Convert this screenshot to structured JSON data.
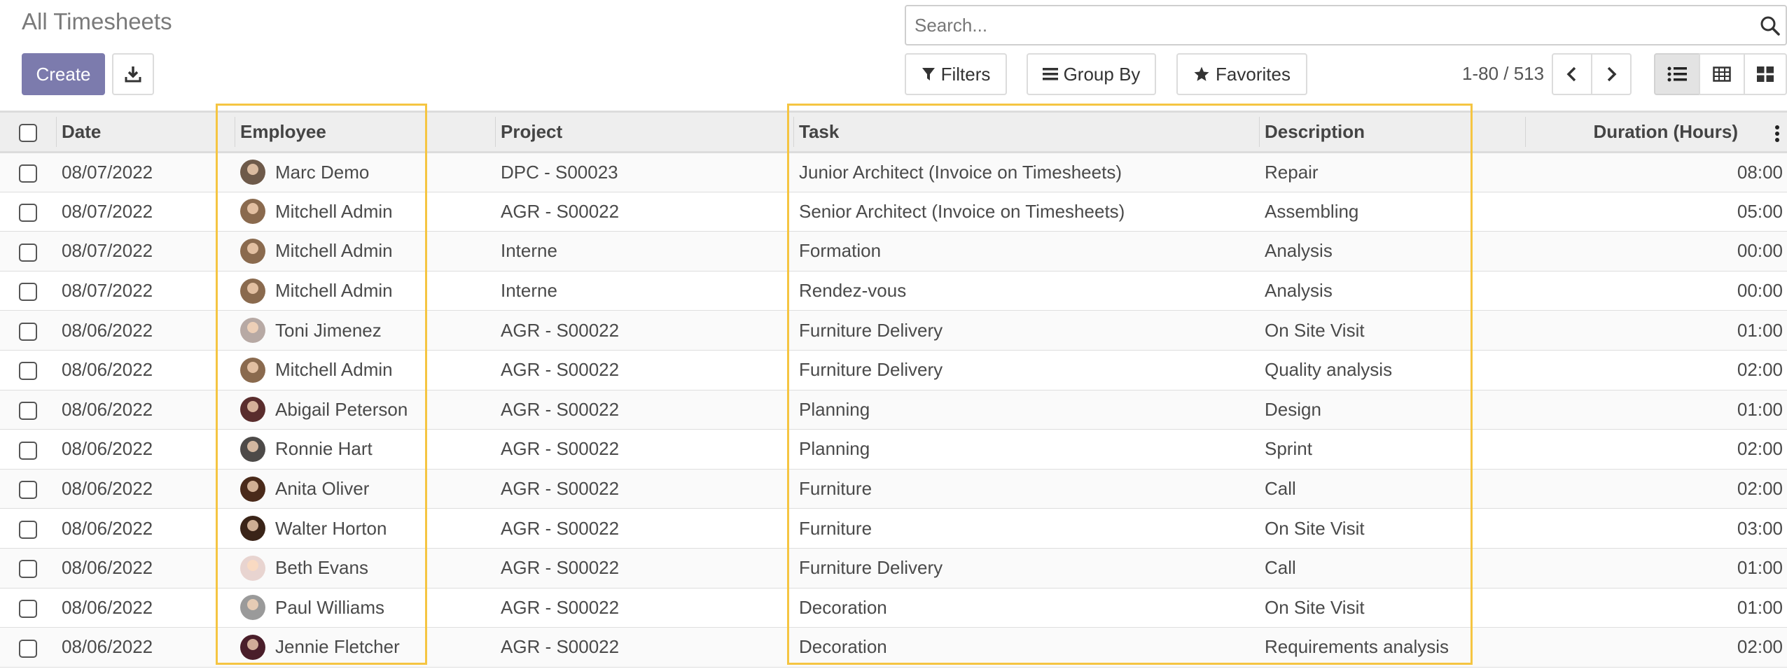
{
  "page": {
    "title": "All Timesheets"
  },
  "search": {
    "placeholder": "Search..."
  },
  "toolbar": {
    "create_label": "Create",
    "filters_label": "Filters",
    "groupby_label": "Group By",
    "favorites_label": "Favorites"
  },
  "pager": {
    "text": "1-80 / 513"
  },
  "colors": {
    "accent": "#7c7bad",
    "highlight": "#f5c542"
  },
  "table": {
    "headers": {
      "date": "Date",
      "employee": "Employee",
      "project": "Project",
      "task": "Task",
      "description": "Description",
      "duration": "Duration (Hours)"
    },
    "rows": [
      {
        "date": "08/07/2022",
        "employee": "Marc Demo",
        "avatar_color": "#6e5a4a",
        "project": "DPC - S00023",
        "task": "Junior Architect (Invoice on Timesheets)",
        "description": "Repair",
        "duration": "08:00"
      },
      {
        "date": "08/07/2022",
        "employee": "Mitchell Admin",
        "avatar_color": "#8a6a4e",
        "project": "AGR - S00022",
        "task": "Senior Architect (Invoice on Timesheets)",
        "description": "Assembling",
        "duration": "05:00"
      },
      {
        "date": "08/07/2022",
        "employee": "Mitchell Admin",
        "avatar_color": "#8a6a4e",
        "project": "Interne",
        "task": "Formation",
        "description": "Analysis",
        "duration": "00:00"
      },
      {
        "date": "08/07/2022",
        "employee": "Mitchell Admin",
        "avatar_color": "#8a6a4e",
        "project": "Interne",
        "task": "Rendez-vous",
        "description": "Analysis",
        "duration": "00:00"
      },
      {
        "date": "08/06/2022",
        "employee": "Toni Jimenez",
        "avatar_color": "#b7a9a4",
        "project": "AGR - S00022",
        "task": "Furniture Delivery",
        "description": "On Site Visit",
        "duration": "01:00"
      },
      {
        "date": "08/06/2022",
        "employee": "Mitchell Admin",
        "avatar_color": "#8a6a4e",
        "project": "AGR - S00022",
        "task": "Furniture Delivery",
        "description": "Quality analysis",
        "duration": "02:00"
      },
      {
        "date": "08/06/2022",
        "employee": "Abigail Peterson",
        "avatar_color": "#5a2d2d",
        "project": "AGR - S00022",
        "task": "Planning",
        "description": "Design",
        "duration": "01:00"
      },
      {
        "date": "08/06/2022",
        "employee": "Ronnie Hart",
        "avatar_color": "#4d4a48",
        "project": "AGR - S00022",
        "task": "Planning",
        "description": "Sprint",
        "duration": "02:00"
      },
      {
        "date": "08/06/2022",
        "employee": "Anita Oliver",
        "avatar_color": "#4a2a1a",
        "project": "AGR - S00022",
        "task": "Furniture",
        "description": "Call",
        "duration": "02:00"
      },
      {
        "date": "08/06/2022",
        "employee": "Walter Horton",
        "avatar_color": "#3a2418",
        "project": "AGR - S00022",
        "task": "Furniture",
        "description": "On Site Visit",
        "duration": "03:00"
      },
      {
        "date": "08/06/2022",
        "employee": "Beth Evans",
        "avatar_color": "#e8d4d0",
        "project": "AGR - S00022",
        "task": "Furniture Delivery",
        "description": "Call",
        "duration": "01:00"
      },
      {
        "date": "08/06/2022",
        "employee": "Paul Williams",
        "avatar_color": "#9a9a9a",
        "project": "AGR - S00022",
        "task": "Decoration",
        "description": "On Site Visit",
        "duration": "01:00"
      },
      {
        "date": "08/06/2022",
        "employee": "Jennie Fletcher",
        "avatar_color": "#4a1e2a",
        "project": "AGR - S00022",
        "task": "Decoration",
        "description": "Requirements analysis",
        "duration": "02:00"
      }
    ]
  }
}
